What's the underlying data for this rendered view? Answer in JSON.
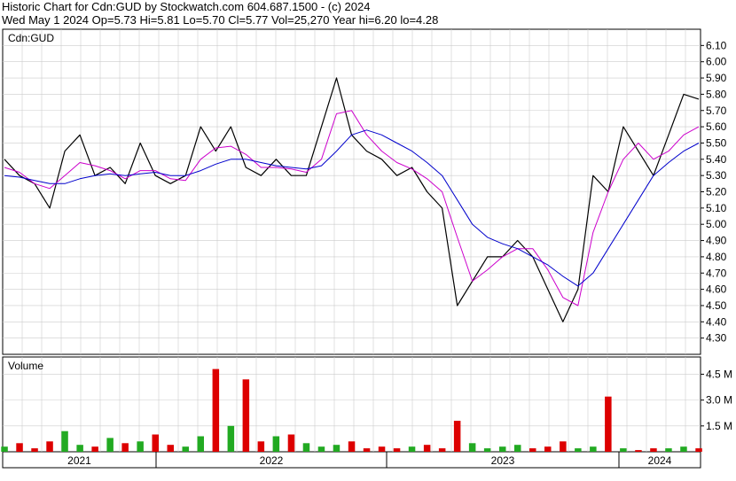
{
  "header": {
    "line1": "Historic Chart for Cdn:GUD by Stockwatch.com 604.687.1500 - (c) 2024",
    "line2": "Wed May  1 2024  Op=5.73  Hi=5.81  Lo=5.70  Cl=5.77  Vol=25,270  Year hi=6.20  lo=4.28"
  },
  "colors": {
    "price": "#000000",
    "ma_short": "#cc00cc",
    "ma_long": "#0000cc",
    "vol_up": "#22aa22",
    "vol_down": "#dd0000",
    "grid": "#cccccc"
  },
  "chart_data": [
    {
      "type": "line",
      "title": "",
      "legend": "Cdn:GUD",
      "xlabel": "",
      "ylabel": "",
      "x_ticks": [
        "2021",
        "2022",
        "2023",
        "2024"
      ],
      "y_ticks": [
        4.3,
        4.4,
        4.5,
        4.6,
        4.7,
        4.8,
        4.9,
        5.0,
        5.1,
        5.2,
        5.3,
        5.4,
        5.5,
        5.6,
        5.7,
        5.8,
        5.9,
        6.0,
        6.1
      ],
      "ylim": [
        4.2,
        6.2
      ],
      "grid": true,
      "x": [
        "2020-11",
        "2020-12",
        "2021-01",
        "2021-02",
        "2021-03",
        "2021-04",
        "2021-05",
        "2021-06",
        "2021-07",
        "2021-08",
        "2021-09",
        "2021-10",
        "2021-11",
        "2021-12",
        "2022-01",
        "2022-02",
        "2022-03",
        "2022-04",
        "2022-05",
        "2022-06",
        "2022-07",
        "2022-08",
        "2022-09",
        "2022-10",
        "2022-11",
        "2022-12",
        "2023-01",
        "2023-02",
        "2023-03",
        "2023-04",
        "2023-05",
        "2023-06",
        "2023-07",
        "2023-08",
        "2023-09",
        "2023-10",
        "2023-11",
        "2023-12",
        "2024-01",
        "2024-02",
        "2024-03",
        "2024-04",
        "2024-05"
      ],
      "series": [
        {
          "values": [
            5.4,
            5.3,
            5.25,
            5.1,
            5.45,
            5.55,
            5.3,
            5.35,
            5.25,
            5.5,
            5.3,
            5.25,
            5.3,
            5.6,
            5.45,
            5.6,
            5.35,
            5.3,
            5.4,
            5.3,
            5.3,
            5.6,
            5.9,
            5.55,
            5.45,
            5.4,
            5.3,
            5.35,
            5.2,
            5.1,
            4.5,
            4.65,
            4.8,
            4.8,
            4.9,
            4.8,
            4.6,
            4.4,
            4.6,
            5.3,
            5.2,
            5.6,
            5.45,
            5.3,
            5.55,
            5.8,
            5.77
          ]
        },
        {
          "values": [
            5.35,
            5.32,
            5.25,
            5.22,
            5.3,
            5.38,
            5.36,
            5.33,
            5.28,
            5.33,
            5.33,
            5.28,
            5.27,
            5.4,
            5.47,
            5.48,
            5.43,
            5.35,
            5.35,
            5.34,
            5.32,
            5.4,
            5.68,
            5.7,
            5.55,
            5.45,
            5.38,
            5.34,
            5.28,
            5.2,
            4.92,
            4.65,
            4.72,
            4.8,
            4.85,
            4.85,
            4.72,
            4.55,
            4.5,
            4.95,
            5.2,
            5.4,
            5.5,
            5.4,
            5.45,
            5.55,
            5.6
          ]
        },
        {
          "values": [
            5.3,
            5.29,
            5.27,
            5.25,
            5.25,
            5.28,
            5.3,
            5.31,
            5.3,
            5.31,
            5.32,
            5.3,
            5.3,
            5.33,
            5.37,
            5.4,
            5.4,
            5.38,
            5.36,
            5.35,
            5.34,
            5.36,
            5.45,
            5.55,
            5.58,
            5.55,
            5.5,
            5.45,
            5.38,
            5.3,
            5.15,
            5.0,
            4.92,
            4.88,
            4.85,
            4.8,
            4.75,
            4.68,
            4.62,
            4.7,
            4.85,
            5.0,
            5.15,
            5.3,
            5.38,
            5.45,
            5.5
          ]
        }
      ]
    },
    {
      "type": "bar",
      "legend": "Volume",
      "y_ticks": [
        "1.5 M",
        "3.0 M",
        "4.5 M"
      ],
      "ylim": [
        0,
        5.5
      ],
      "series": [
        {
          "values": [
            0.3,
            0.5,
            0.2,
            0.6,
            1.2,
            0.4,
            0.3,
            0.8,
            0.5,
            0.6,
            1.0,
            0.4,
            0.3,
            0.9,
            4.8,
            1.5,
            4.2,
            0.6,
            0.9,
            1.0,
            0.5,
            0.3,
            0.4,
            0.6,
            0.2,
            0.3,
            0.2,
            0.3,
            0.4,
            0.2,
            1.8,
            0.5,
            0.2,
            0.3,
            0.4,
            0.2,
            0.3,
            0.6,
            0.2,
            0.3,
            3.2,
            0.2,
            0.1,
            0.2,
            0.2,
            0.3,
            0.2
          ]
        }
      ]
    }
  ]
}
